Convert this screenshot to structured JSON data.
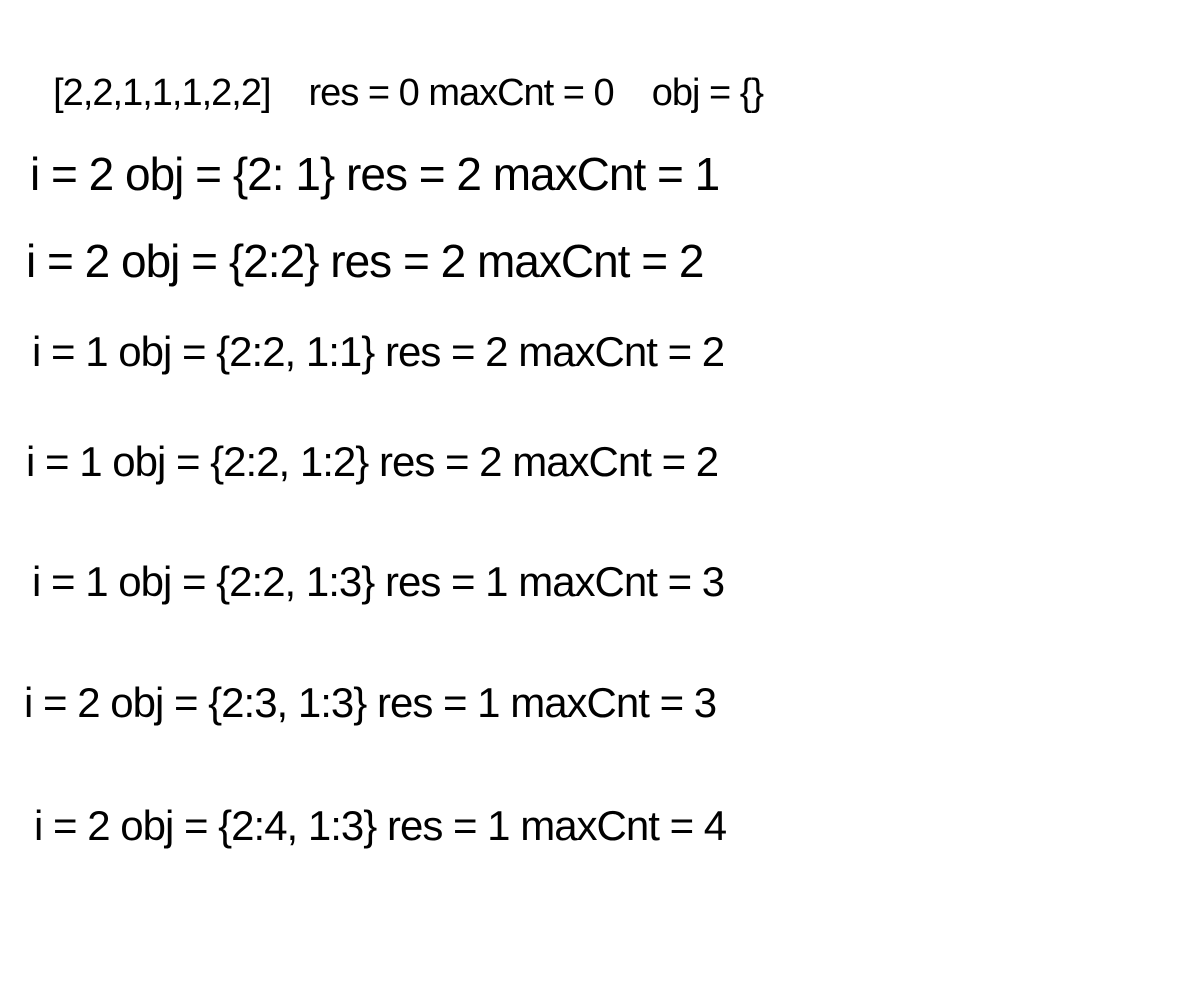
{
  "header": {
    "array": "[2,2,1,1,1,2,2]",
    "init_vars": "res = 0 maxCnt = 0",
    "init_obj": "obj = {}"
  },
  "steps": [
    "i = 2 obj = {2: 1} res = 2 maxCnt = 1",
    "i = 2 obj = {2:2} res = 2 maxCnt = 2",
    "i = 1 obj = {2:2, 1:1} res = 2 maxCnt = 2",
    "i = 1 obj = {2:2, 1:2} res = 2 maxCnt = 2",
    "i = 1 obj = {2:2, 1:3} res = 1 maxCnt = 3",
    "i = 2 obj = {2:3, 1:3} res = 1 maxCnt = 3",
    "i = 2 obj = {2:4, 1:3} res = 1 maxCnt = 4"
  ]
}
